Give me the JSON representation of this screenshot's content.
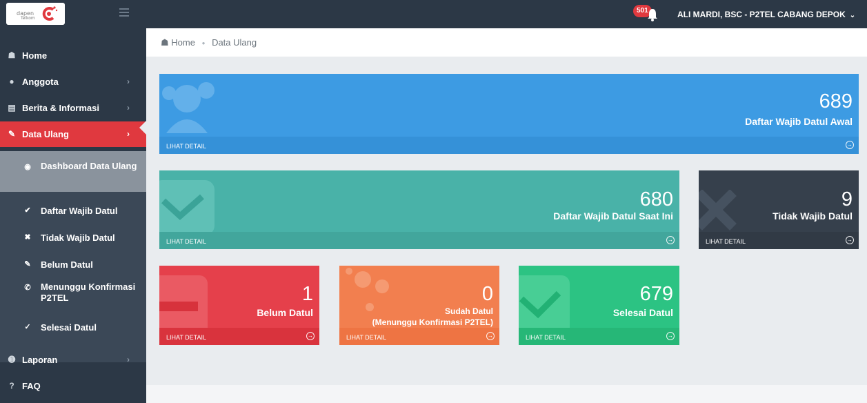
{
  "header": {
    "logo": {
      "line1": "dapen",
      "line2": "Telkom"
    },
    "notification_count": "501",
    "user_label": "ALI MARDI, BSC - P2TEL CABANG DEPOK"
  },
  "sidebar": {
    "items": [
      {
        "label": "Home",
        "icon": "home-icon"
      },
      {
        "label": "Anggota",
        "icon": "user-icon"
      },
      {
        "label": "Berita & Informasi",
        "icon": "newspaper-icon"
      },
      {
        "label": "Data Ulang",
        "icon": "pencil-icon"
      },
      {
        "label": "Laporan",
        "icon": "info-icon"
      },
      {
        "label": "FAQ",
        "icon": "question-icon"
      }
    ],
    "subitems": [
      {
        "label": "Dashboard Data Ulang",
        "icon": "dashboard-icon"
      },
      {
        "label": "Daftar Wajib Datul",
        "icon": "check-circle-icon"
      },
      {
        "label": "Tidak Wajib Datul",
        "icon": "times-circle-icon"
      },
      {
        "label": "Belum Datul",
        "icon": "pencil-icon"
      },
      {
        "label": "Menunggu Konfirmasi P2TEL",
        "icon": "phone-icon"
      },
      {
        "label": "Selesai Datul",
        "icon": "check-icon"
      }
    ]
  },
  "breadcrumb": {
    "home": "Home",
    "current": "Data Ulang"
  },
  "tiles": {
    "awal": {
      "value": "689",
      "title": "Daftar Wajib Datul Awal",
      "link": "LIHAT DETAIL",
      "color": "#3d9be3"
    },
    "saat_ini": {
      "value": "680",
      "title": "Daftar Wajib Datul Saat Ini",
      "link": "LIHAT DETAIL",
      "color": "#49b2a8"
    },
    "tidak_wajib": {
      "value": "9",
      "title": "Tidak Wajib Datul",
      "link": "LIHAT DETAIL",
      "color": "#36404c"
    },
    "belum": {
      "value": "1",
      "title": "Belum Datul",
      "link": "LIHAT DETAIL",
      "color": "#e5404b"
    },
    "sudah": {
      "value": "0",
      "title": "Sudah Datul",
      "subtitle": "(Menunggu Konfirmasi P2TEL)",
      "link": "LIHAT DETAIL",
      "color": "#f27f4f"
    },
    "selesai": {
      "value": "679",
      "title": "Selesai Datul",
      "link": "LIHAT DETAIL",
      "color": "#2cc383"
    }
  },
  "colors": {
    "sidebar": "#2c3846",
    "active": "#e0393f",
    "background": "#e9ecef"
  }
}
